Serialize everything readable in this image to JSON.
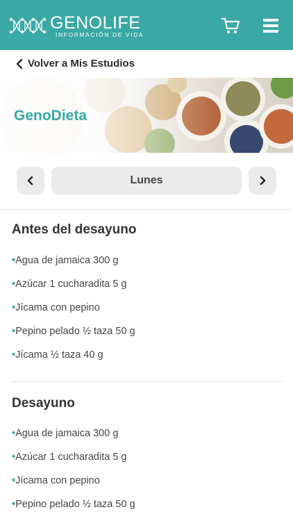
{
  "header": {
    "brand_name": "GENOLIFE",
    "brand_tagline": "INFORMACIÓN DE VIDA",
    "cart_icon": "cart-icon",
    "menu_icon": "hamburger-menu-icon",
    "color": "#3aa9a6"
  },
  "nav": {
    "back_label": "Volver a Mis Estudios"
  },
  "banner": {
    "title": "GenoDieta"
  },
  "day_selector": {
    "current_day": "Lunes",
    "prev_icon": "chevron-left-icon",
    "next_icon": "chevron-right-icon"
  },
  "meals": [
    {
      "title": "Antes del desayuno",
      "items": [
        "Agua de jamaica 300 g",
        "Azúcar 1 cucharadita 5 g",
        "Jícama con pepino",
        "Pepino pelado ½ taza 50 g",
        "Jícama ½ taza 40 g"
      ]
    },
    {
      "title": "Desayuno",
      "items": [
        "Agua de jamaica 300 g",
        "Azúcar 1 cucharadita 5 g",
        "Jícama con pepino",
        "Pepino pelado ½ taza 50 g"
      ]
    }
  ],
  "bullet": "•"
}
